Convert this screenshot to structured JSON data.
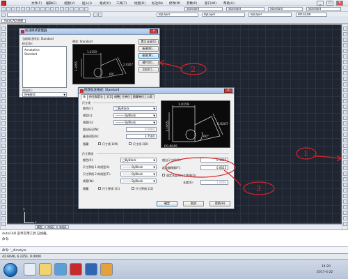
{
  "menubar": {
    "items": [
      "文件(F)",
      "编辑(E)",
      "视图(V)",
      "插入(I)",
      "格式(O)",
      "工具(T)",
      "绘图(D)",
      "标注(N)",
      "修改(M)",
      "参数(P)",
      "窗口(W)",
      "帮助(H)"
    ],
    "win_buttons": [
      "_",
      "□",
      "×"
    ]
  },
  "toolbar": {
    "style_combo_1": "Standard",
    "style_combo_2": "Standard",
    "style_combo_3": "Standard",
    "style_combo_4": "Standard",
    "layer_combo": "ByLayer",
    "linetype_combo": "ByLayer",
    "lineweight_combo": "ByLayer",
    "color_combo": "BYCOLOR"
  },
  "document_tab": "AutoCAD 经典",
  "ucs": {
    "x": "X",
    "y": "Y"
  },
  "layout_tabs": [
    "模型",
    "布局1",
    "布局2"
  ],
  "command": {
    "history_1": "AutoCAD 菜单实用工具 已加载。",
    "history_2": "命令:",
    "prompt": "命令: '_dimstyle"
  },
  "status": {
    "coords": "42.6046, 6.2251, 0.0000"
  },
  "tray": {
    "time": "14:20",
    "date": "2017-4-22"
  },
  "dialog_manager": {
    "title": "标注样式管理器",
    "current_style": "当前标注样式: Standard",
    "styles_label": "样式(S):",
    "styles": [
      "Annotative",
      "Standard"
    ],
    "preview_label": "预览: Standard",
    "list_label": "列出(L):",
    "list_value": "所有样式",
    "checkbox_label": "不列出外部参照中的样式(D)",
    "buttons": [
      "置为当前(U)",
      "新建(N)...",
      "修改(M)...",
      "替代(O)...",
      "比较(C)..."
    ]
  },
  "dialog_modify": {
    "title": "修改标注样式: Standard",
    "tabs": [
      "线",
      "符号和箭头",
      "文字",
      "调整",
      "主单位",
      "换算单位",
      "公差"
    ],
    "dim_lines_group": "尺寸线",
    "color_label": "颜色(C):",
    "color_value": "□ByBlock",
    "linetype_label": "线型(L):",
    "linetype_value": "——— ByBlock",
    "lineweight_label": "线宽(G):",
    "lineweight_value": "——— ByBlock",
    "extend_ticks_label": "超出标记(N):",
    "extend_ticks_value": "0.0000",
    "baseline_label": "基线间距(A):",
    "baseline_value": "3.7500",
    "suppress_label": "隐藏:",
    "suppress_1": "尺寸线 1(M)",
    "suppress_2": "尺寸线 2(D)",
    "ext_lines_group": "尺寸界线",
    "ext_color_label": "颜色(R):",
    "ext_color_value": "□ByBlock",
    "ext_lt1_label": "尺寸界线 1 的线型(I):",
    "ext_lt1_value": "——— ByBlock",
    "ext_lt2_label": "尺寸界线 2 的线型(T):",
    "ext_lt2_value": "——— ByBlock",
    "ext_lw_label": "线宽(W):",
    "ext_lw_value": "——— ByBlock",
    "ext_suppress_label": "隐藏:",
    "ext_suppress_1": "尺寸界线 1(1)",
    "ext_suppress_2": "尺寸界线 2(2)",
    "extend_beyond_label": "超出尺寸线(X):",
    "extend_beyond_value": "0.1800",
    "offset_label": "起点偏移量(F):",
    "offset_value": "0.0625",
    "fixed_length_label": "固定长度的尺寸界线(O)",
    "length_label": "长度(E):",
    "length_value": "1.0000",
    "ok": "确定",
    "cancel": "取消",
    "help": "帮助(H)",
    "preview_dims": [
      "1.0159",
      "1.1955",
      "2.0207",
      "60°",
      "R0.8045"
    ]
  },
  "annotations": [
    "1",
    "2",
    "3"
  ],
  "colors": {
    "canvas": "#1f2531",
    "annotation": "#d8262b",
    "dialog_title": "#a9c1e3"
  }
}
